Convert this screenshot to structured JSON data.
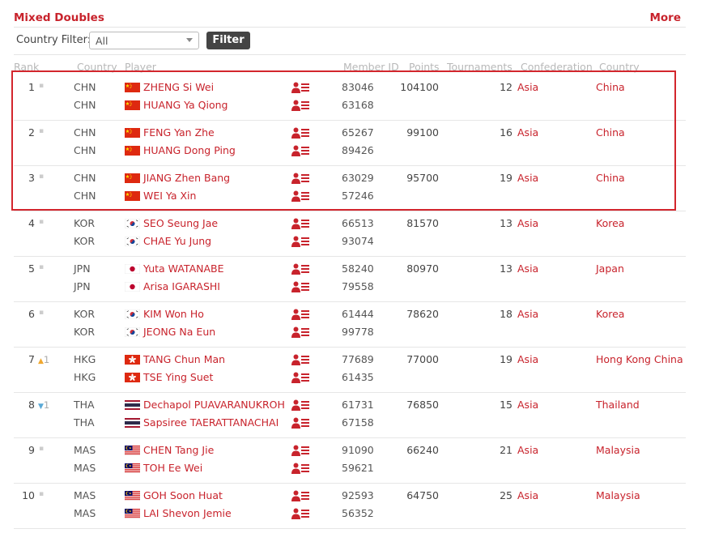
{
  "section": {
    "title": "Mixed Doubles",
    "more_label": "More"
  },
  "filter": {
    "label": "Country Filter:",
    "selected": "All",
    "button_label": "Filter"
  },
  "columns": {
    "rank": "Rank",
    "country": "Country",
    "player": "Player",
    "member_id": "Member ID",
    "points": "Points",
    "tournaments": "Tournaments",
    "confederation": "Confederation",
    "country_name": "Country"
  },
  "rows": [
    {
      "rank": "1",
      "movement": "none",
      "movement_value": "",
      "points": "104100",
      "tournaments": "12",
      "confederation": "Asia",
      "country": "China",
      "players": [
        {
          "code": "CHN",
          "flag": "cn-flag",
          "name": "ZHENG Si Wei",
          "member_id": "83046"
        },
        {
          "code": "CHN",
          "flag": "cn-flag",
          "name": "HUANG Ya Qiong",
          "member_id": "63168"
        }
      ]
    },
    {
      "rank": "2",
      "movement": "none",
      "movement_value": "",
      "points": "99100",
      "tournaments": "16",
      "confederation": "Asia",
      "country": "China",
      "players": [
        {
          "code": "CHN",
          "flag": "cn-flag",
          "name": "FENG Yan Zhe",
          "member_id": "65267"
        },
        {
          "code": "CHN",
          "flag": "cn-flag",
          "name": "HUANG Dong Ping",
          "member_id": "89426"
        }
      ]
    },
    {
      "rank": "3",
      "movement": "none",
      "movement_value": "",
      "points": "95700",
      "tournaments": "19",
      "confederation": "Asia",
      "country": "China",
      "players": [
        {
          "code": "CHN",
          "flag": "cn-flag",
          "name": "JIANG Zhen Bang",
          "member_id": "63029"
        },
        {
          "code": "CHN",
          "flag": "cn-flag",
          "name": "WEI Ya Xin",
          "member_id": "57246"
        }
      ]
    },
    {
      "rank": "4",
      "movement": "none",
      "movement_value": "",
      "points": "81570",
      "tournaments": "13",
      "confederation": "Asia",
      "country": "Korea",
      "players": [
        {
          "code": "KOR",
          "flag": "kr-flag",
          "name": "SEO Seung Jae",
          "member_id": "66513"
        },
        {
          "code": "KOR",
          "flag": "kr-flag",
          "name": "CHAE Yu Jung",
          "member_id": "93074"
        }
      ]
    },
    {
      "rank": "5",
      "movement": "none",
      "movement_value": "",
      "points": "80970",
      "tournaments": "13",
      "confederation": "Asia",
      "country": "Japan",
      "players": [
        {
          "code": "JPN",
          "flag": "jp-flag",
          "name": "Yuta WATANABE",
          "member_id": "58240"
        },
        {
          "code": "JPN",
          "flag": "jp-flag",
          "name": "Arisa IGARASHI",
          "member_id": "79558"
        }
      ]
    },
    {
      "rank": "6",
      "movement": "none",
      "movement_value": "",
      "points": "78620",
      "tournaments": "18",
      "confederation": "Asia",
      "country": "Korea",
      "players": [
        {
          "code": "KOR",
          "flag": "kr-flag",
          "name": "KIM Won Ho",
          "member_id": "61444"
        },
        {
          "code": "KOR",
          "flag": "kr-flag",
          "name": "JEONG Na Eun",
          "member_id": "99778"
        }
      ]
    },
    {
      "rank": "7",
      "movement": "up",
      "movement_value": "1",
      "points": "77000",
      "tournaments": "19",
      "confederation": "Asia",
      "country": "Hong Kong China",
      "players": [
        {
          "code": "HKG",
          "flag": "hk-flag",
          "name": "TANG Chun Man",
          "member_id": "77689"
        },
        {
          "code": "HKG",
          "flag": "hk-flag",
          "name": "TSE Ying Suet",
          "member_id": "61435"
        }
      ]
    },
    {
      "rank": "8",
      "movement": "down",
      "movement_value": "1",
      "points": "76850",
      "tournaments": "15",
      "confederation": "Asia",
      "country": "Thailand",
      "players": [
        {
          "code": "THA",
          "flag": "th-flag",
          "name": "Dechapol PUAVARANUKROH",
          "member_id": "61731"
        },
        {
          "code": "THA",
          "flag": "th-flag",
          "name": "Sapsiree TAERATTANACHAI",
          "member_id": "67158"
        }
      ]
    },
    {
      "rank": "9",
      "movement": "none",
      "movement_value": "",
      "points": "66240",
      "tournaments": "21",
      "confederation": "Asia",
      "country": "Malaysia",
      "players": [
        {
          "code": "MAS",
          "flag": "my-flag",
          "name": "CHEN Tang Jie",
          "member_id": "91090"
        },
        {
          "code": "MAS",
          "flag": "my-flag",
          "name": "TOH Ee Wei",
          "member_id": "59621"
        }
      ]
    },
    {
      "rank": "10",
      "movement": "none",
      "movement_value": "",
      "points": "64750",
      "tournaments": "25",
      "confederation": "Asia",
      "country": "Malaysia",
      "players": [
        {
          "code": "MAS",
          "flag": "my-flag",
          "name": "GOH Soon Huat",
          "member_id": "92593"
        },
        {
          "code": "MAS",
          "flag": "my-flag",
          "name": "LAI Shevon Jemie",
          "member_id": "56352"
        }
      ]
    }
  ],
  "colors": {
    "accent": "#c8232c",
    "highlight_border": "#d3262d"
  }
}
